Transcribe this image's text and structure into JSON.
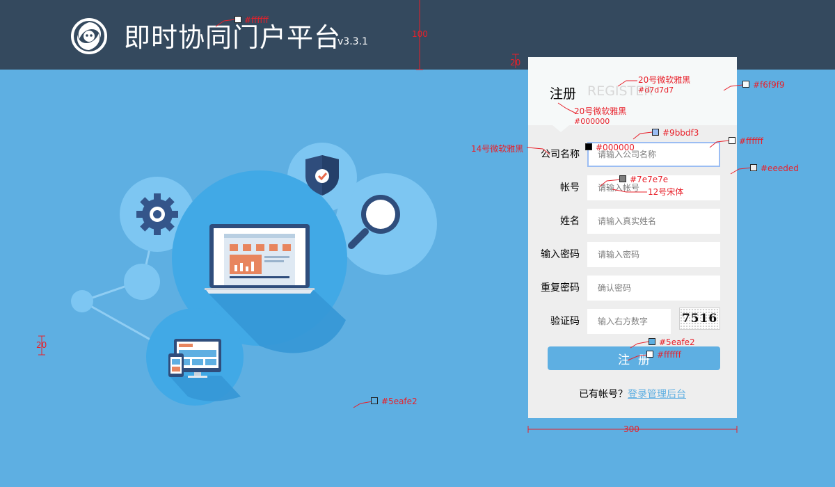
{
  "header": {
    "title": "即时协同门户平台",
    "version": "v3.3.1"
  },
  "register": {
    "tab_cn": "注册",
    "tab_en": "REGISTER",
    "fields": [
      {
        "label": "公司名称",
        "placeholder": "请输入公司名称"
      },
      {
        "label": "帐号",
        "placeholder": "请输入帐号"
      },
      {
        "label": "姓名",
        "placeholder": "请输入真实姓名"
      },
      {
        "label": "输入密码",
        "placeholder": "请输入密码"
      },
      {
        "label": "重复密码",
        "placeholder": "确认密码"
      },
      {
        "label": "验证码",
        "placeholder": "输入右方数字"
      }
    ],
    "captcha_text": "7516",
    "submit_label": "注册",
    "login_prompt": "已有帐号？",
    "login_link": "登录管理后台"
  },
  "annotations": {
    "header_height": "100",
    "panel_top_gap": "20",
    "left_gap": "20",
    "panel_width": "300",
    "header_color": "#ffffff",
    "tab_en_font": "20号微软雅黑",
    "tab_en_color": "#d7d7d7",
    "tab_cn_font": "20号微软雅黑",
    "tab_cn_color": "#000000",
    "panel_head_color": "#f6f9f9",
    "input_border_color": "#9bbdf3",
    "label_font": "14号微软雅黑",
    "label_color": "#000000",
    "input_bg_color": "#ffffff",
    "panel_bg_color": "#eeeded",
    "placeholder_color": "#7e7e7e",
    "placeholder_font": "12号宋体",
    "button_color": "#5eafe2",
    "button_text_color": "#ffffff",
    "bg_color": "#5eafe2"
  },
  "colors": {
    "header_bg": "#34495e",
    "page_bg": "#5eafe2",
    "panel_bg": "#eeeeee",
    "panel_head_bg": "#f6f9f9",
    "accent": "#5eafe2",
    "focus_border": "#9bbdf3",
    "annotation_red": "#e8202a"
  },
  "icons": [
    "logo-icon",
    "gear-icon",
    "shield-check-icon",
    "magnifier-icon",
    "laptop-icon",
    "devices-icon"
  ]
}
